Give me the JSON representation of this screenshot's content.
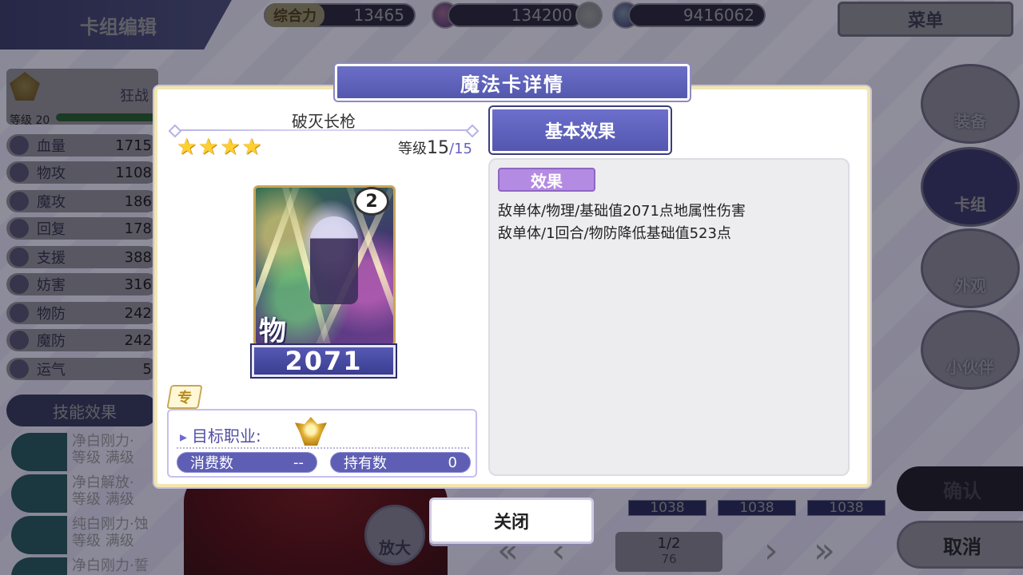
{
  "hud": {
    "title": "卡组编辑",
    "power_label": "综合力",
    "power_value": "13465",
    "currency1_value": "134200",
    "currency2_value": "9416062",
    "menu_label": "菜单"
  },
  "left_panel": {
    "job_name": "狂战",
    "level_text": "等级 20",
    "stats": [
      {
        "name": "血量",
        "value": "1715"
      },
      {
        "name": "物攻",
        "value": "1108"
      },
      {
        "name": "魔攻",
        "value": "186"
      },
      {
        "name": "回复",
        "value": "178"
      },
      {
        "name": "支援",
        "value": "388"
      },
      {
        "name": "妨害",
        "value": "316"
      },
      {
        "name": "物防",
        "value": "242"
      },
      {
        "name": "魔防",
        "value": "242"
      },
      {
        "name": "运气",
        "value": "5"
      }
    ],
    "skill_header": "技能效果",
    "skills": [
      {
        "line1": "净白刚力·",
        "line2": "等级 满级"
      },
      {
        "line1": "净白解放·",
        "line2": "等级 满级"
      },
      {
        "line1": "纯白刚力·蚀",
        "line2": "等级 满级"
      },
      {
        "line1": "净白刚力·誓",
        "line2": ""
      }
    ]
  },
  "right_menu": {
    "items": [
      "装备",
      "卡组",
      "外观",
      "小伙伴"
    ],
    "confirm": "确认",
    "cancel": "取消"
  },
  "bottom": {
    "card_values": [
      "1038",
      "1038",
      "1038"
    ],
    "zoom_label": "放大",
    "page": "1/2",
    "page_total": "76"
  },
  "modal": {
    "title": "魔法卡详情",
    "card_name": "破灭长枪",
    "stars": 4,
    "level_label": "等级",
    "level_current": "15",
    "level_max": "/15",
    "card_cost": "2",
    "card_type": "物",
    "card_value": "2071",
    "exclusive_tag": "专",
    "target_job_label": "目标职业:",
    "consume_label": "消费数",
    "consume_value": "--",
    "owned_label": "持有数",
    "owned_value": "0",
    "effect_tab": "基本效果",
    "effect_label": "效果",
    "effect_lines": [
      "敌单体/物理/基础值2071点地属性伤害",
      "敌单体/1回合/物防降低基础值523点"
    ],
    "close_label": "关闭"
  }
}
